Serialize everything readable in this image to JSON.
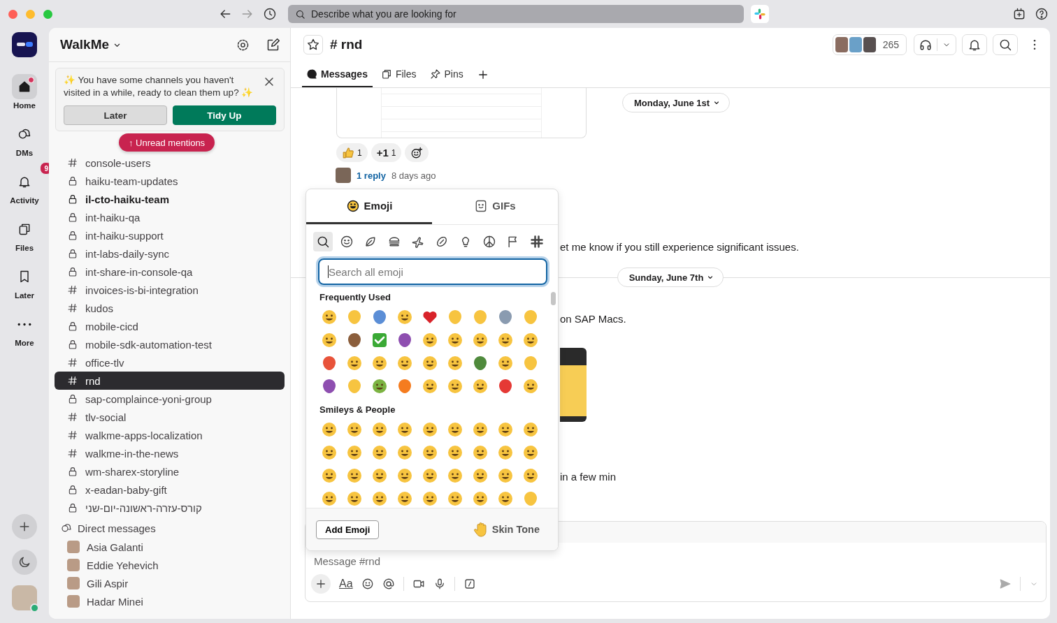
{
  "titlebar": {
    "search": {
      "placeholder": "Describe what you are looking for"
    }
  },
  "rail": {
    "items": [
      {
        "kind": "home",
        "label": "Home",
        "selected": true,
        "unread_dot": true
      },
      {
        "kind": "dms",
        "label": "DMs",
        "selected": false,
        "unread_dot": false
      },
      {
        "kind": "activity",
        "label": "Activity",
        "selected": false,
        "unread_dot": false,
        "badge": "9"
      },
      {
        "kind": "files",
        "label": "Files",
        "selected": false,
        "unread_dot": false
      },
      {
        "kind": "later",
        "label": "Later",
        "selected": false,
        "unread_dot": false
      },
      {
        "kind": "more",
        "label": "More",
        "selected": false,
        "unread_dot": false
      }
    ]
  },
  "sidebar": {
    "workspace": "WalkMe",
    "banner": {
      "text": "✨ You have some channels you haven't visited in a while, ready to clean them up? ✨",
      "buttons": [
        {
          "kind": "secondary",
          "label": "Later"
        },
        {
          "kind": "primary",
          "label": "Tidy Up"
        }
      ]
    },
    "unread_pill": "↑ Unread mentions",
    "channels": [
      {
        "kind": "public",
        "name": "console-users",
        "unread": false,
        "selected": false
      },
      {
        "kind": "private",
        "name": "haiku-team-updates",
        "unread": false,
        "selected": false
      },
      {
        "kind": "private",
        "name": "il-cto-haiku-team",
        "unread": true,
        "selected": false
      },
      {
        "kind": "private",
        "name": "int-haiku-qa",
        "unread": false,
        "selected": false
      },
      {
        "kind": "private",
        "name": "int-haiku-support",
        "unread": false,
        "selected": false
      },
      {
        "kind": "private",
        "name": "int-labs-daily-sync",
        "unread": false,
        "selected": false
      },
      {
        "kind": "private",
        "name": "int-share-in-console-qa",
        "unread": false,
        "selected": false
      },
      {
        "kind": "public",
        "name": "invoices-is-bi-integration",
        "unread": false,
        "selected": false
      },
      {
        "kind": "public",
        "name": "kudos",
        "unread": false,
        "selected": false
      },
      {
        "kind": "private",
        "name": "mobile-cicd",
        "unread": false,
        "selected": false
      },
      {
        "kind": "private",
        "name": "mobile-sdk-automation-test",
        "unread": false,
        "selected": false
      },
      {
        "kind": "public",
        "name": "office-tlv",
        "unread": false,
        "selected": false
      },
      {
        "kind": "public",
        "name": "rnd",
        "unread": false,
        "selected": true
      },
      {
        "kind": "private",
        "name": "sap-complaince-yoni-group",
        "unread": false,
        "selected": false
      },
      {
        "kind": "public",
        "name": "tlv-social",
        "unread": false,
        "selected": false
      },
      {
        "kind": "public",
        "name": "walkme-apps-localization",
        "unread": false,
        "selected": false
      },
      {
        "kind": "public",
        "name": "walkme-in-the-news",
        "unread": false,
        "selected": false
      },
      {
        "kind": "private",
        "name": "wm-sharex-storyline",
        "unread": false,
        "selected": false
      },
      {
        "kind": "private",
        "name": "x-eadan-baby-gift",
        "unread": false,
        "selected": false
      },
      {
        "kind": "private",
        "name": "קורס-עזרה-ראשונה-יום-שני",
        "unread": false,
        "selected": false
      }
    ],
    "dm_heading": "Direct messages",
    "dms": [
      {
        "name": "Asia Galanti"
      },
      {
        "name": "Eddie Yehevich"
      },
      {
        "name": "Gili Aspir"
      },
      {
        "name": "Hadar Minei"
      }
    ]
  },
  "channel": {
    "title": "# rnd",
    "member_count": "265",
    "tabs": [
      {
        "kind": "messages",
        "label": "Messages",
        "selected": true
      },
      {
        "kind": "files",
        "label": "Files",
        "selected": false
      },
      {
        "kind": "pins",
        "label": "Pins",
        "selected": false
      }
    ],
    "date_dividers": [
      "Monday, June 1st",
      "Sunday, June 7th"
    ],
    "reactions": [
      {
        "kind": "thumbs",
        "count": "1"
      },
      {
        "kind": "plus_one",
        "label": "+1",
        "count": "1"
      }
    ],
    "thread": {
      "link": "1 reply",
      "time": "8 days ago"
    },
    "messages": [
      "et me know if you still experience significant issues.",
      "on SAP Macs.",
      "in a few min"
    ],
    "composer": {
      "placeholder": "Message #rnd",
      "format_label": "Aa"
    }
  },
  "emoji_picker": {
    "tabs": [
      {
        "kind": "emoji",
        "label": "Emoji",
        "selected": true
      },
      {
        "kind": "gifs",
        "label": "GIFs",
        "selected": false
      }
    ],
    "categories": [
      {
        "kind": "search",
        "selected": true
      },
      {
        "kind": "smiley",
        "selected": false
      },
      {
        "kind": "leaf",
        "selected": false
      },
      {
        "kind": "burger",
        "selected": false
      },
      {
        "kind": "plane",
        "selected": false
      },
      {
        "kind": "ball",
        "selected": false
      },
      {
        "kind": "bulb",
        "selected": false
      },
      {
        "kind": "peace",
        "selected": false
      },
      {
        "kind": "flag",
        "selected": false
      },
      {
        "kind": "slack",
        "selected": false
      }
    ],
    "search": {
      "placeholder": "Search all emoji"
    },
    "sections": [
      {
        "title": "Frequently Used",
        "emoji": [
          {
            "kind": "face",
            "color": "#f7c440"
          },
          {
            "kind": "other",
            "color": "#f7c440"
          },
          {
            "kind": "other",
            "color": "#5b8ed6"
          },
          {
            "kind": "face",
            "color": "#f7c440"
          },
          {
            "kind": "heart",
            "color": "#d8232a"
          },
          {
            "kind": "other",
            "color": "#f7c440"
          },
          {
            "kind": "other",
            "color": "#f7c440"
          },
          {
            "kind": "other",
            "color": "#8a9bb0"
          },
          {
            "kind": "other",
            "color": "#f7c440"
          },
          {
            "kind": "face",
            "color": "#f7c440"
          },
          {
            "kind": "other",
            "color": "#8b5e3c"
          },
          {
            "kind": "check",
            "color": "#3aa935"
          },
          {
            "kind": "other",
            "color": "#8e4fb0"
          },
          {
            "kind": "face",
            "color": "#f7c440"
          },
          {
            "kind": "face",
            "color": "#f7c440"
          },
          {
            "kind": "face",
            "color": "#f7c440"
          },
          {
            "kind": "face",
            "color": "#f7c440"
          },
          {
            "kind": "face",
            "color": "#f7c440"
          },
          {
            "kind": "other",
            "color": "#e8533a"
          },
          {
            "kind": "face",
            "color": "#f7c440"
          },
          {
            "kind": "face",
            "color": "#f7c440"
          },
          {
            "kind": "face",
            "color": "#f7c440"
          },
          {
            "kind": "face",
            "color": "#f7c440"
          },
          {
            "kind": "face",
            "color": "#f7c440"
          },
          {
            "kind": "other",
            "color": "#4f8a3c"
          },
          {
            "kind": "face",
            "color": "#f7c440"
          },
          {
            "kind": "other",
            "color": "#f7c440"
          },
          {
            "kind": "other",
            "color": "#8e4fb0"
          },
          {
            "kind": "other",
            "color": "#f7c440"
          },
          {
            "kind": "face",
            "color": "#7cb342"
          },
          {
            "kind": "other",
            "color": "#f57c1f"
          },
          {
            "kind": "face",
            "color": "#f7c440"
          },
          {
            "kind": "face",
            "color": "#f7c440"
          },
          {
            "kind": "face",
            "color": "#f7c440"
          },
          {
            "kind": "other",
            "color": "#e53935"
          },
          {
            "kind": "face",
            "color": "#f7c440"
          }
        ]
      },
      {
        "title": "Smileys & People",
        "emoji": [
          {
            "kind": "face",
            "color": "#f7c440"
          },
          {
            "kind": "face",
            "color": "#f7c440"
          },
          {
            "kind": "face",
            "color": "#f7c440"
          },
          {
            "kind": "face",
            "color": "#f7c440"
          },
          {
            "kind": "face",
            "color": "#f7c440"
          },
          {
            "kind": "face",
            "color": "#f7c440"
          },
          {
            "kind": "face",
            "color": "#f7c440"
          },
          {
            "kind": "face",
            "color": "#f7c440"
          },
          {
            "kind": "face",
            "color": "#f7c440"
          },
          {
            "kind": "face",
            "color": "#f7c440"
          },
          {
            "kind": "face",
            "color": "#f7c440"
          },
          {
            "kind": "face",
            "color": "#f7c440"
          },
          {
            "kind": "face",
            "color": "#f7c440"
          },
          {
            "kind": "face",
            "color": "#f7c440"
          },
          {
            "kind": "face",
            "color": "#f7c440"
          },
          {
            "kind": "face",
            "color": "#f7c440"
          },
          {
            "kind": "face",
            "color": "#f7c440"
          },
          {
            "kind": "face",
            "color": "#f7c440"
          },
          {
            "kind": "face",
            "color": "#f7c440"
          },
          {
            "kind": "face",
            "color": "#f7c440"
          },
          {
            "kind": "face",
            "color": "#f7c440"
          },
          {
            "kind": "face",
            "color": "#f7c440"
          },
          {
            "kind": "face",
            "color": "#f7c440"
          },
          {
            "kind": "face",
            "color": "#f7c440"
          },
          {
            "kind": "face",
            "color": "#f7c440"
          },
          {
            "kind": "face",
            "color": "#f7c440"
          },
          {
            "kind": "face",
            "color": "#f7c440"
          },
          {
            "kind": "face",
            "color": "#f7c440"
          },
          {
            "kind": "face",
            "color": "#f7c440"
          },
          {
            "kind": "face",
            "color": "#f7c440"
          },
          {
            "kind": "face",
            "color": "#f7c440"
          },
          {
            "kind": "face",
            "color": "#f7c440"
          },
          {
            "kind": "face",
            "color": "#f7c440"
          },
          {
            "kind": "face",
            "color": "#f7c440"
          },
          {
            "kind": "face",
            "color": "#f7c440"
          },
          {
            "kind": "other",
            "color": "#f7c440"
          }
        ]
      }
    ],
    "footer": {
      "add_button": "Add Emoji",
      "skin_tone": "Skin Tone"
    }
  }
}
